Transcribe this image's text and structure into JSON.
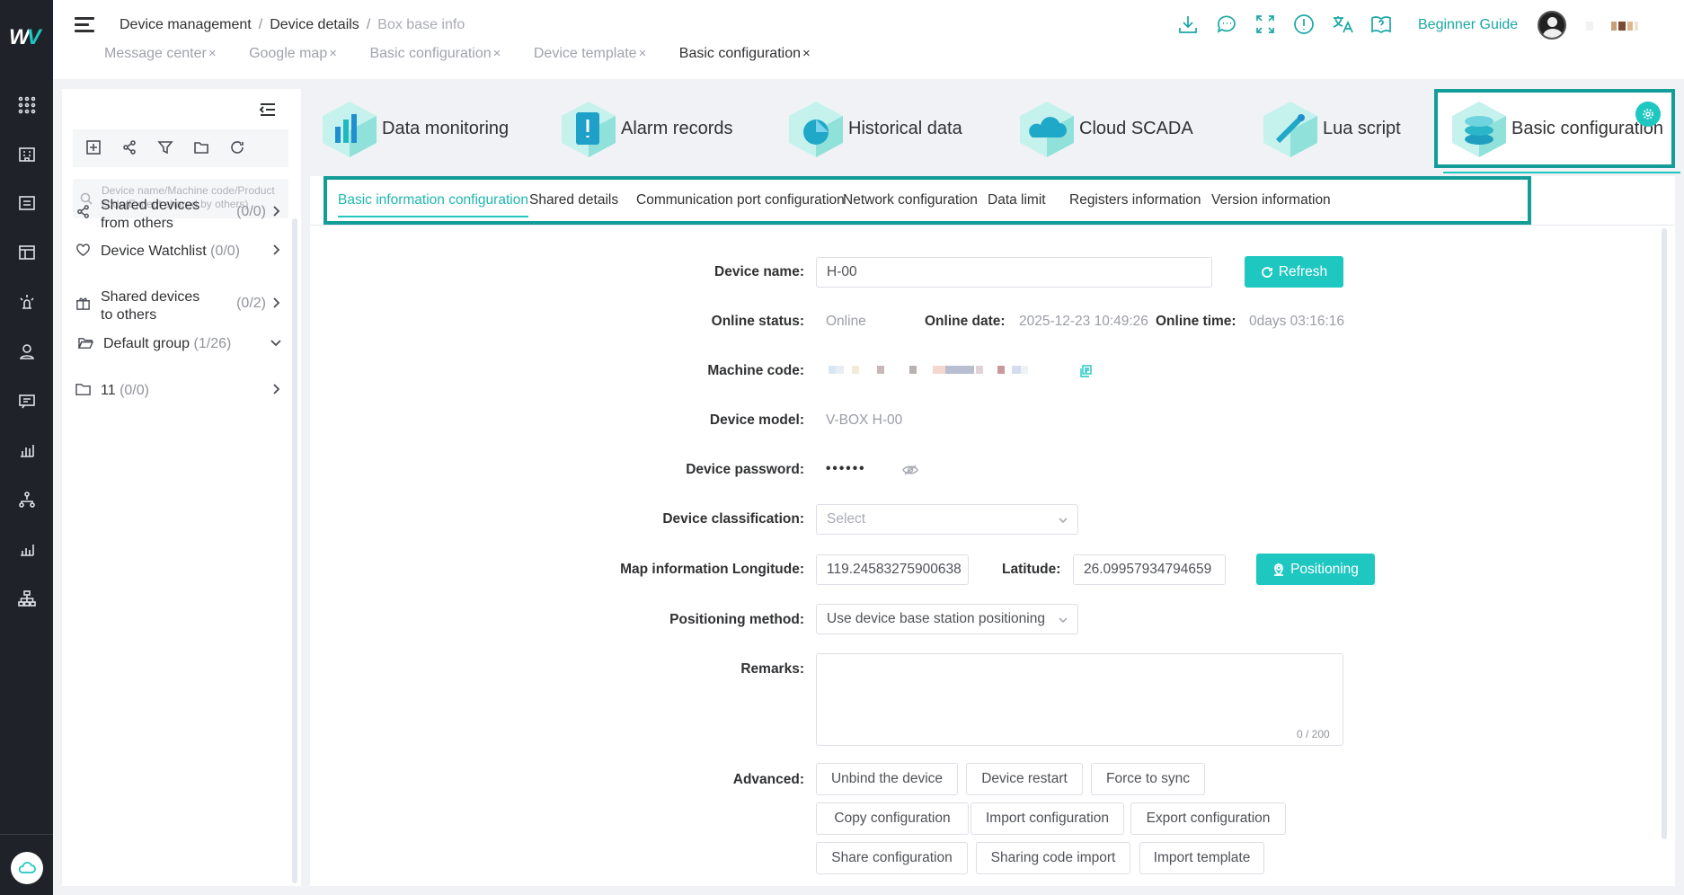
{
  "header": {
    "breadcrumb": [
      "Device management",
      "Device details",
      "Box base info"
    ],
    "tabs": [
      {
        "label": "Message center"
      },
      {
        "label": "Google map"
      },
      {
        "label": "Basic configuration"
      },
      {
        "label": "Device template"
      },
      {
        "label": "Basic configuration"
      }
    ],
    "tab_close": "×",
    "guide": "Beginner Guide",
    "icons": [
      "download-icon",
      "chat-icon",
      "fullscreen-icon",
      "info-icon",
      "translate-icon",
      "help-book-icon"
    ]
  },
  "sidebar": {
    "search_placeholder": "Device name/Machine code/Product code(Except shared by others)",
    "groups": [
      {
        "label": "Shared devices from others",
        "count": "(0/0)",
        "icon": "share-icon"
      },
      {
        "label": "Device Watchlist",
        "count": "(0/0)",
        "icon": "heart-icon"
      },
      {
        "label": "Shared devices to others",
        "count": "(0/2)",
        "icon": "gift-icon"
      },
      {
        "label": "Default group",
        "count": "(1/26)",
        "icon": "folder-icon"
      },
      {
        "label": "11",
        "count": "(0/0)",
        "icon": "folder-icon"
      }
    ]
  },
  "cards": [
    {
      "label": "Data monitoring"
    },
    {
      "label": "Alarm records"
    },
    {
      "label": "Historical data"
    },
    {
      "label": "Cloud SCADA"
    },
    {
      "label": "Lua script"
    },
    {
      "label": "Basic configuration"
    }
  ],
  "subtabs": [
    "Basic information configuration",
    "Shared details",
    "Communication port configuration",
    "Network configuration",
    "Data limit",
    "Registers information",
    "Version information"
  ],
  "form": {
    "device_name_label": "Device name:",
    "device_name_value": "H-00",
    "refresh_label": "Refresh",
    "online_status_label": "Online status:",
    "online_status_value": "Online",
    "online_date_label": "Online date:",
    "online_date_value": "2025-12-23 10:49:26",
    "online_time_label": "Online time:",
    "online_time_value": "0days 03:16:16",
    "machine_code_label": "Machine code:",
    "device_model_label": "Device model:",
    "device_model_value": "V-BOX H-00",
    "device_password_label": "Device password:",
    "device_password_value": "••••••",
    "classification_label": "Device classification:",
    "classification_placeholder": "Select",
    "longitude_label": "Map information Longitude:",
    "longitude_value": "119.24583275900638",
    "latitude_label": "Latitude:",
    "latitude_value": "26.09957934794659",
    "positioning_label": "Positioning",
    "positioning_method_label": "Positioning method:",
    "positioning_method_value": "Use device base station positioning",
    "remarks_label": "Remarks:",
    "remarks_counter": "0 / 200",
    "advanced_label": "Advanced:",
    "advanced_buttons": [
      "Unbind the device",
      "Device restart",
      "Force to sync",
      "Copy configuration",
      "Import configuration",
      "Export configuration",
      "Share configuration",
      "Sharing code import",
      "Import template"
    ]
  },
  "colors": {
    "accent": "#1fc7c1",
    "highlight_border": "#139d98",
    "rail": "#1f2329"
  }
}
